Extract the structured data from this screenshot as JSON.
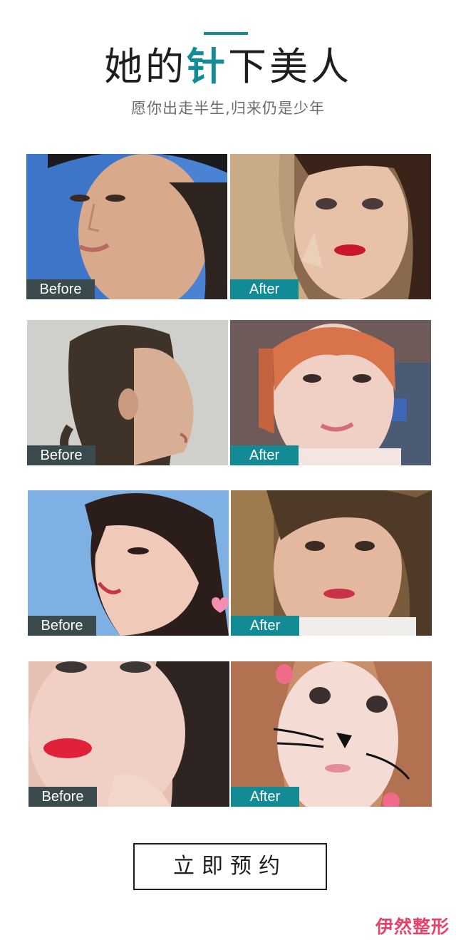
{
  "header": {
    "title_pre": "她的",
    "title_highlight": "针",
    "title_post": "下美人",
    "subtitle": "愿你出走半生,归来仍是少年"
  },
  "cases": [
    {
      "before_label": "Before",
      "after_label": "After"
    },
    {
      "before_label": "Before",
      "after_label": "After"
    },
    {
      "before_label": "Before",
      "after_label": "After"
    },
    {
      "before_label": "Before",
      "after_label": "After"
    }
  ],
  "cta": {
    "label": "立即预约"
  },
  "brand": {
    "logo_text": "伊然整形"
  },
  "colors": {
    "accent": "#128b94",
    "before_badge": "#3a4a4d",
    "logo": "#e8416b"
  }
}
